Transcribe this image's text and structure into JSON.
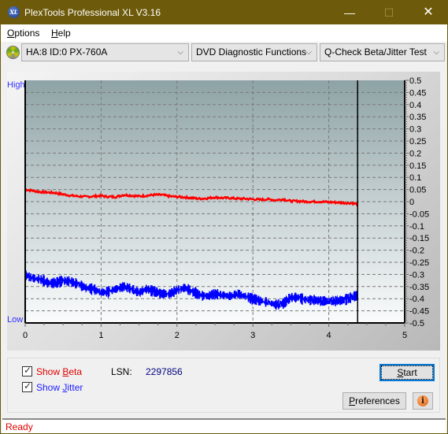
{
  "window": {
    "title": "PlexTools Professional XL V3.16",
    "app_icon": "xl-logo-icon",
    "app_icon_text": "XL",
    "minimize": "—",
    "maximize": "☐",
    "close": "✕"
  },
  "menu": {
    "items": [
      {
        "label": "Options",
        "mnemonic": "O",
        "rest": "ptions"
      },
      {
        "label": "Help",
        "mnemonic": "H",
        "rest": "elp"
      }
    ]
  },
  "toolbar": {
    "drive_icon": "disc-icon",
    "drive_select": "HA:8 ID:0  PX-760A",
    "function_select": "DVD Diagnostic Functions",
    "test_select": "Q-Check Beta/Jitter Test",
    "chevron": "⌵"
  },
  "chart_data": {
    "type": "line",
    "title": "",
    "xlabel": "",
    "ylabel": "",
    "left_axis_labels": {
      "top": "High",
      "bottom": "Low"
    },
    "xlim": [
      0,
      5
    ],
    "ylim": [
      -0.5,
      0.5
    ],
    "x_ticks": [
      "0",
      "1",
      "2",
      "3",
      "4",
      "5"
    ],
    "y_ticks": [
      "0.5",
      "0.45",
      "0.4",
      "0.35",
      "0.3",
      "0.25",
      "0.2",
      "0.15",
      "0.1",
      "0.05",
      "0",
      "-0.05",
      "-0.1",
      "-0.15",
      "-0.2",
      "-0.25",
      "-0.3",
      "-0.35",
      "-0.4",
      "-0.45",
      "-0.5"
    ],
    "grid": true,
    "end_marker_x": 4.38,
    "series": [
      {
        "name": "Beta",
        "color": "#ff0000",
        "x": [
          0,
          0.1,
          0.2,
          0.3,
          0.4,
          0.5,
          0.6,
          0.7,
          0.8,
          0.9,
          1.0,
          1.1,
          1.2,
          1.3,
          1.4,
          1.5,
          1.6,
          1.7,
          1.8,
          1.9,
          2.0,
          2.1,
          2.2,
          2.3,
          2.4,
          2.5,
          2.6,
          2.7,
          2.8,
          2.9,
          3.0,
          3.1,
          3.2,
          3.3,
          3.4,
          3.5,
          3.6,
          3.7,
          3.8,
          3.9,
          4.0,
          4.1,
          4.2,
          4.3,
          4.38
        ],
        "values": [
          0.05,
          0.045,
          0.04,
          0.038,
          0.036,
          0.03,
          0.025,
          0.022,
          0.02,
          0.022,
          0.024,
          0.02,
          0.02,
          0.028,
          0.025,
          0.022,
          0.025,
          0.028,
          0.028,
          0.022,
          0.02,
          0.018,
          0.015,
          0.012,
          0.014,
          0.018,
          0.015,
          0.015,
          0.012,
          0.012,
          0.01,
          0.008,
          0.01,
          0.006,
          0.01,
          0.002,
          0.002,
          0.0,
          0.0,
          0.0,
          -0.002,
          -0.003,
          -0.005,
          -0.006,
          -0.01
        ]
      },
      {
        "name": "Jitter",
        "color": "#0000ff",
        "x": [
          0,
          0.05,
          0.1,
          0.2,
          0.3,
          0.4,
          0.5,
          0.6,
          0.7,
          0.8,
          0.9,
          1.0,
          1.1,
          1.2,
          1.3,
          1.4,
          1.5,
          1.6,
          1.7,
          1.8,
          1.9,
          2.0,
          2.1,
          2.2,
          2.3,
          2.4,
          2.5,
          2.6,
          2.7,
          2.8,
          2.9,
          3.0,
          3.1,
          3.2,
          3.3,
          3.4,
          3.5,
          3.6,
          3.7,
          3.8,
          3.9,
          4.0,
          4.1,
          4.2,
          4.3,
          4.38
        ],
        "values": [
          -0.3,
          -0.31,
          -0.315,
          -0.32,
          -0.335,
          -0.335,
          -0.325,
          -0.33,
          -0.34,
          -0.355,
          -0.36,
          -0.375,
          -0.37,
          -0.36,
          -0.35,
          -0.36,
          -0.375,
          -0.36,
          -0.37,
          -0.38,
          -0.38,
          -0.365,
          -0.355,
          -0.37,
          -0.385,
          -0.39,
          -0.38,
          -0.385,
          -0.39,
          -0.38,
          -0.39,
          -0.4,
          -0.41,
          -0.415,
          -0.425,
          -0.42,
          -0.395,
          -0.395,
          -0.405,
          -0.405,
          -0.41,
          -0.41,
          -0.41,
          -0.405,
          -0.395,
          -0.385
        ]
      }
    ]
  },
  "controls": {
    "show_beta_label_pre": "Show ",
    "show_beta_mnemonic": "B",
    "show_beta_label_post": "eta",
    "show_beta_checked": true,
    "show_jitter_label_pre": "Show ",
    "show_jitter_mnemonic": "J",
    "show_jitter_label_post": "itter",
    "show_jitter_checked": true,
    "lsn_label": "LSN:",
    "lsn_value": "2297856",
    "start_mnemonic": "S",
    "start_rest": "tart",
    "preferences_mnemonic": "P",
    "preferences_rest": "references",
    "info_icon_glyph": "i"
  },
  "status": {
    "text": "Ready"
  },
  "colors": {
    "titlebar": "#6d5a0a",
    "beta": "#ff0000",
    "jitter": "#0000ff",
    "axis_label_blue": "#3030ff",
    "lsn_value": "#000080",
    "status_text": "#e00000"
  }
}
